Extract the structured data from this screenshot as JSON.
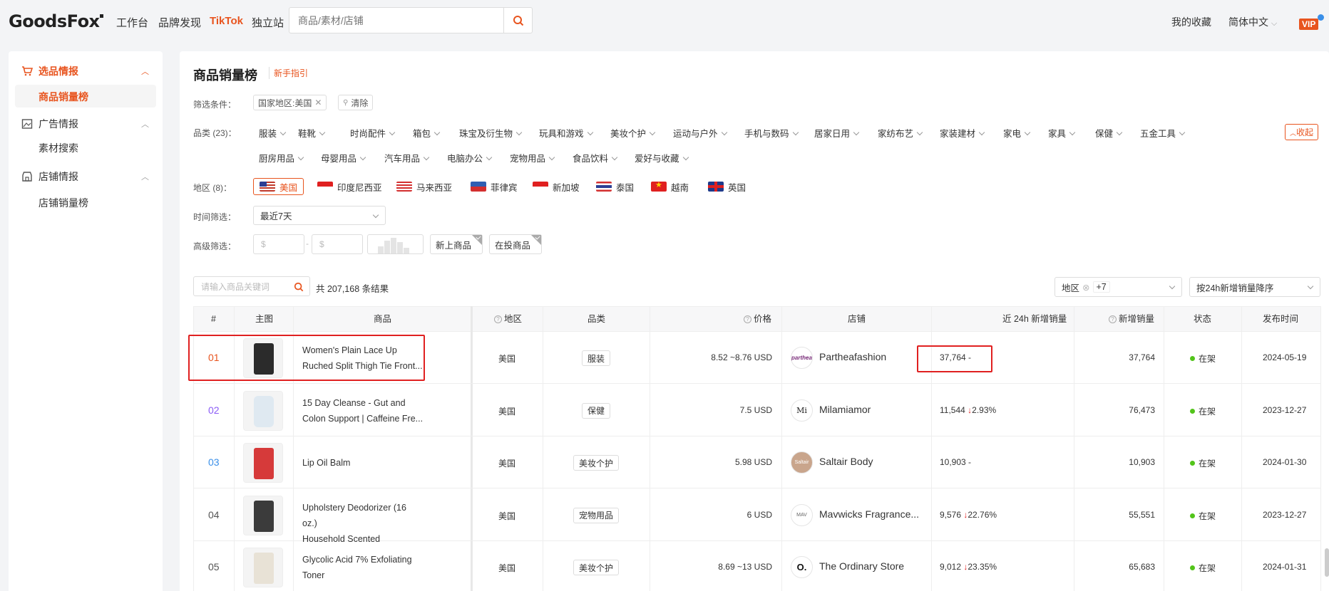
{
  "header": {
    "logo": "GoodsFox",
    "nav": [
      "工作台",
      "品牌发现",
      "TikTok",
      "独立站"
    ],
    "search_placeholder": "商品/素材/店铺",
    "favorites": "我的收藏",
    "language": "简体中文",
    "vip": "VIP"
  },
  "sidebar": {
    "groups": [
      {
        "label": "选品情报",
        "items": [
          "商品销量榜"
        ]
      },
      {
        "label": "广告情报",
        "items": [
          "素材搜索"
        ]
      },
      {
        "label": "店铺情报",
        "items": [
          "店铺销量榜"
        ]
      }
    ]
  },
  "page": {
    "title": "商品销量榜",
    "guide": "新手指引",
    "filter_label": "筛选条件：",
    "active_filter": "国家地区:美国",
    "clear": "清除",
    "category_label": "品类 (23)：",
    "categories_row1": [
      "服装",
      "鞋靴",
      "时尚配件",
      "箱包",
      "珠宝及衍生物",
      "玩具和游戏",
      "美妆个护",
      "运动与户外",
      "手机与数码",
      "居家日用",
      "家纺布艺",
      "家装建材",
      "家电",
      "家具",
      "保健",
      "五金工具"
    ],
    "categories_row2": [
      "厨房用品",
      "母婴用品",
      "汽车用品",
      "电脑办公",
      "宠物用品",
      "食品饮料",
      "爱好与收藏"
    ],
    "collapse": "收起",
    "region_label": "地区 (8)：",
    "regions": [
      "美国",
      "印度尼西亚",
      "马来西亚",
      "菲律宾",
      "新加坡",
      "泰国",
      "越南",
      "英国"
    ],
    "time_label": "时间筛选：",
    "time_value": "最近7天",
    "advanced_label": "高级筛选：",
    "price_placeholder": "$",
    "new_items": "新上商品",
    "advertising_items": "在投商品",
    "keyword_placeholder": "请输入商品关键词",
    "result_count": "共 207,168 条结果",
    "region_select": "地区",
    "region_extra": "+7",
    "sort_select": "按24h新增销量降序"
  },
  "table": {
    "columns": [
      "#",
      "主图",
      "商品",
      "地区",
      "品类",
      "价格",
      "店铺",
      "近 24h 新增销量",
      "新增销量",
      "状态",
      "发布时间"
    ],
    "rows": [
      {
        "rank": "01",
        "name1": "Women's Plain Lace Up",
        "name2": "Ruched Split Thigh Tie Front...",
        "region": "美国",
        "category": "服装",
        "price": "8.52 ~8.76 USD",
        "shop": "Partheafashion",
        "logo": "parthea",
        "sales24": "37,764",
        "change": "-",
        "sales": "37,764",
        "status": "在架",
        "date": "2024-05-19"
      },
      {
        "rank": "02",
        "name1": "15 Day Cleanse - Gut and",
        "name2": "Colon Support | Caffeine Fre...",
        "region": "美国",
        "category": "保健",
        "price": "7.5 USD",
        "shop": "Milamiamor",
        "logo": "Mi",
        "sales24": "11,544",
        "change": "2.93%",
        "sales": "76,473",
        "status": "在架",
        "date": "2023-12-27"
      },
      {
        "rank": "03",
        "name1": "Lip Oil Balm",
        "name2": "",
        "region": "美国",
        "category": "美妆个护",
        "price": "5.98 USD",
        "shop": "Saltair Body",
        "logo": "Saltair",
        "sales24": "10,903",
        "change": "-",
        "sales": "10,903",
        "status": "在架",
        "date": "2024-01-30"
      },
      {
        "rank": "04",
        "name1": "Upholstery Deodorizer (16 oz.)",
        "name2": "Household Scented",
        "region": "美国",
        "category": "宠物用品",
        "price": "6 USD",
        "shop": "Mavwicks Fragrance...",
        "logo": "MAV",
        "sales24": "9,576",
        "change": "22.76%",
        "sales": "55,551",
        "status": "在架",
        "date": "2023-12-27"
      },
      {
        "rank": "05",
        "name1": "Glycolic Acid 7% Exfoliating",
        "name2": "Toner",
        "region": "美国",
        "category": "美妆个护",
        "price": "8.69 ~13 USD",
        "shop": "The Ordinary Store",
        "logo": "O.",
        "sales24": "9,012",
        "change": "23.35%",
        "sales": "65,683",
        "status": "在架",
        "date": "2024-01-31"
      }
    ]
  },
  "colors": {
    "accent": "#e8541e",
    "highlight_box": "#e02020",
    "status_green": "#52c41a"
  }
}
